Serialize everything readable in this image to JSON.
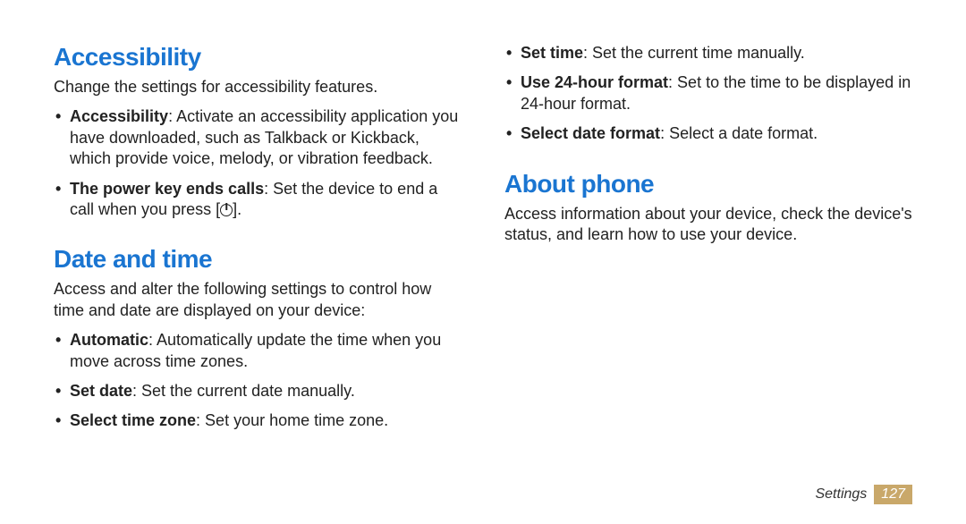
{
  "sections": {
    "accessibility": {
      "heading": "Accessibility",
      "intro": "Change the settings for accessibility features.",
      "items": [
        {
          "bold": "Accessibility",
          "text": ": Activate an accessibility application you have downloaded, such as Talkback or Kickback, which provide voice, melody, or vibration feedback."
        },
        {
          "bold": "The power key ends calls",
          "text_before": ": Set the device to end a call when you press [",
          "text_after": "].",
          "has_power_icon": true
        }
      ]
    },
    "date_time": {
      "heading": "Date and time",
      "intro": "Access and alter the following settings to control how time and date are displayed on your device:",
      "items": [
        {
          "bold": "Automatic",
          "text": ": Automatically update the time when you move across time zones."
        },
        {
          "bold": "Set date",
          "text": ": Set the current date manually."
        },
        {
          "bold": "Select time zone",
          "text": ": Set your home time zone."
        }
      ]
    },
    "date_time_cont": {
      "items": [
        {
          "bold": "Set time",
          "text": ": Set the current time manually."
        },
        {
          "bold": "Use 24-hour format",
          "text": ": Set to the time to be displayed in 24-hour format."
        },
        {
          "bold": "Select date format",
          "text": ": Select a date format."
        }
      ]
    },
    "about_phone": {
      "heading": "About phone",
      "intro": "Access information about your device, check the device's status, and learn how to use your device."
    }
  },
  "footer": {
    "label": "Settings",
    "page": "127"
  }
}
